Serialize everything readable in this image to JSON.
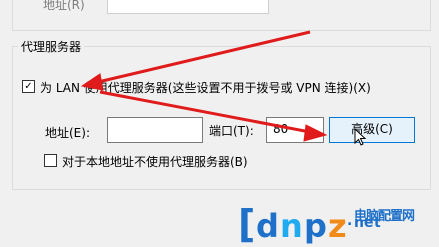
{
  "top_group": {
    "address_label": "地址(R)"
  },
  "proxy_group": {
    "title": "代理服务器",
    "use_proxy": {
      "checked": true,
      "label": "为 LAN 使用代理服务器(这些设置不用于拨号或 VPN 连接)(X)"
    },
    "address_label": "地址(E):",
    "address_value": "",
    "port_label": "端口(T):",
    "port_value": "80",
    "advanced_button": "高级(C)",
    "bypass_local": {
      "checked": false,
      "label": "对于本地地址不使用代理服务器(B)"
    }
  },
  "watermark": {
    "brand_letters": [
      "d",
      "n",
      "p",
      "z",
      ".",
      "n",
      "e",
      "t"
    ],
    "text": "电脑配置网",
    "colors": {
      "blue": "#1e70c8",
      "cyan": "#20aaf0",
      "orange": "#f08a18"
    }
  },
  "annotation": {
    "arrow_color": "#e01b1b"
  }
}
